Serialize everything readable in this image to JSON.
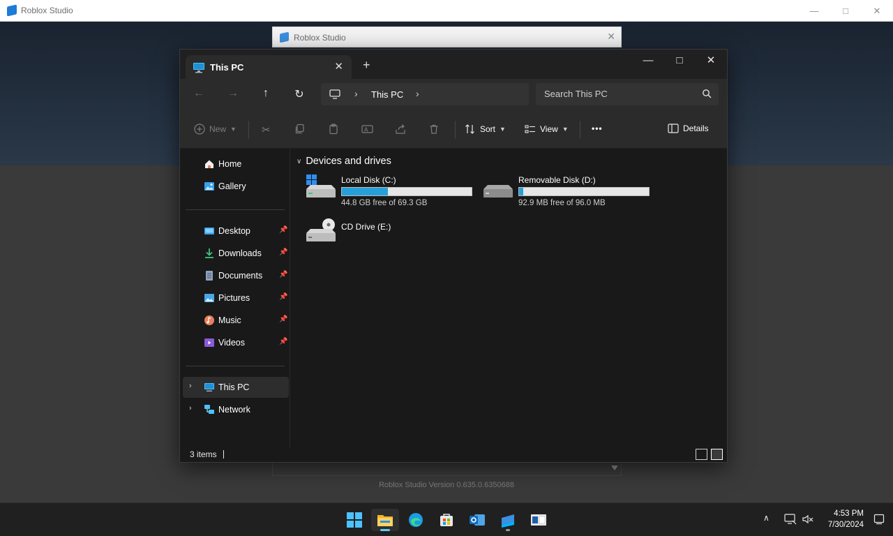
{
  "studio": {
    "title": "Roblox Studio",
    "version": "Roblox Studio Version 0.635.0.6350688"
  },
  "splash": {
    "title": "Roblox Studio"
  },
  "explorer": {
    "tab_title": "This PC",
    "new_tab": "+",
    "breadcrumb": [
      "This PC"
    ],
    "search_placeholder": "Search This PC",
    "toolbar": {
      "new_label": "New",
      "sort_label": "Sort",
      "view_label": "View",
      "more_label": "•••",
      "details_label": "Details"
    },
    "sidebar": {
      "top": [
        {
          "label": "Home",
          "icon": "home-icon"
        },
        {
          "label": "Gallery",
          "icon": "gallery-icon"
        }
      ],
      "quick_access": [
        {
          "label": "Desktop",
          "icon": "desktop-folder-icon",
          "color": "#3aa0e8"
        },
        {
          "label": "Downloads",
          "icon": "downloads-folder-icon",
          "color": "#3fc47a"
        },
        {
          "label": "Documents",
          "icon": "documents-folder-icon",
          "color": "#8fa3bf"
        },
        {
          "label": "Pictures",
          "icon": "pictures-folder-icon",
          "color": "#4aa7e6"
        },
        {
          "label": "Music",
          "icon": "music-folder-icon",
          "color": "#e87f5a"
        },
        {
          "label": "Videos",
          "icon": "videos-folder-icon",
          "color": "#8a5bd6"
        }
      ],
      "bottom": [
        {
          "label": "This PC",
          "icon": "this-pc-icon",
          "selected": true
        },
        {
          "label": "Network",
          "icon": "network-icon"
        }
      ]
    },
    "group_header": "Devices and drives",
    "drives": [
      {
        "name": "Local Disk (C:)",
        "free": "44.8 GB free of 69.3 GB",
        "used_fraction": 0.354,
        "icon": "windows-drive-icon"
      },
      {
        "name": "Removable Disk (D:)",
        "free": "92.9 MB free of 96.0 MB",
        "used_fraction": 0.032,
        "icon": "removable-drive-icon"
      },
      {
        "name": "CD Drive (E:)",
        "free": "",
        "icon": "cd-drive-icon"
      }
    ],
    "status": {
      "item_count": "3 items"
    }
  },
  "taskbar": {
    "apps": [
      "start-icon",
      "file-explorer-icon",
      "edge-icon",
      "store-icon",
      "outlook-icon",
      "roblox-studio-icon",
      "roblox-app-icon"
    ],
    "time": "4:53 PM",
    "date": "7/30/2024"
  },
  "colors": {
    "accent": "#60cdff",
    "drive_bar": "#26a0da"
  }
}
